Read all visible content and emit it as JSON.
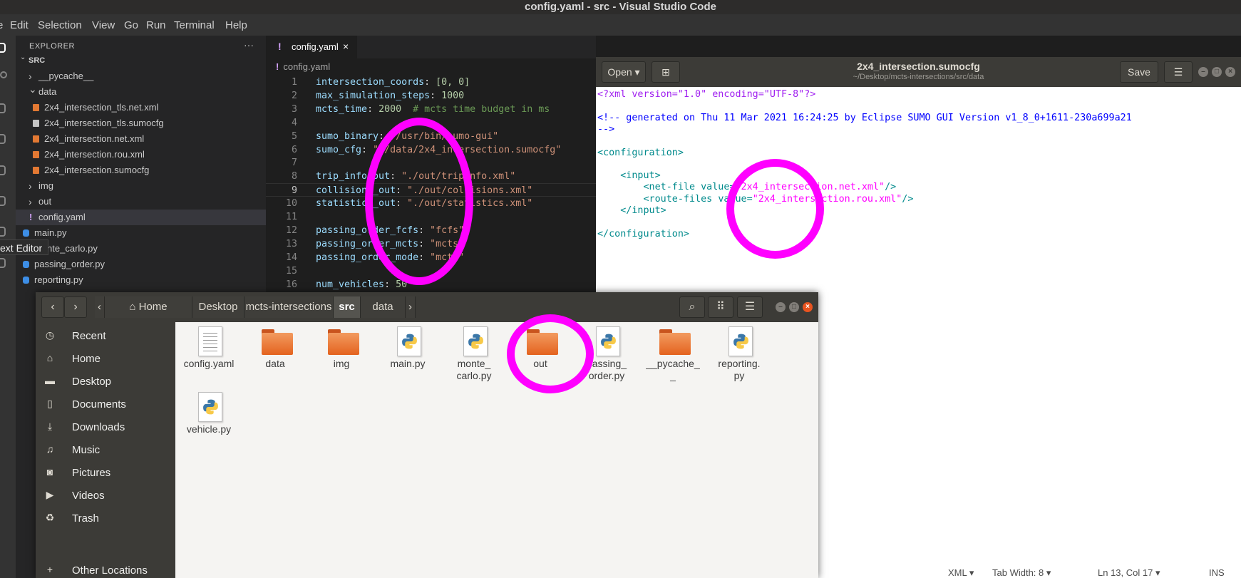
{
  "vscode": {
    "title": "config.yaml - src - Visual Studio Code",
    "menu": [
      "e",
      "Edit",
      "Selection",
      "View",
      "Go",
      "Run",
      "Terminal",
      "Help"
    ],
    "explorer_header": "EXPLORER",
    "more_icon": "···",
    "tooltip": "ext Editor",
    "tree": [
      {
        "label": "SRC",
        "kind": "root"
      },
      {
        "label": "__pycache__",
        "kind": "folder",
        "open": false
      },
      {
        "label": "data",
        "kind": "folder",
        "open": true
      },
      {
        "label": "2x4_intersection_tls.net.xml",
        "kind": "xml"
      },
      {
        "label": "2x4_intersection_tls.sumocfg",
        "kind": "cfg"
      },
      {
        "label": "2x4_intersection.net.xml",
        "kind": "xml"
      },
      {
        "label": "2x4_intersection.rou.xml",
        "kind": "xml"
      },
      {
        "label": "2x4_intersection.sumocfg",
        "kind": "xml"
      },
      {
        "label": "img",
        "kind": "folder",
        "open": false
      },
      {
        "label": "out",
        "kind": "folder",
        "open": false
      },
      {
        "label": "config.yaml",
        "kind": "yaml",
        "selected": true
      },
      {
        "label": "main.py",
        "kind": "py"
      },
      {
        "label": "monte_carlo.py",
        "kind": "py"
      },
      {
        "label": "passing_order.py",
        "kind": "py"
      },
      {
        "label": "reporting.py",
        "kind": "py"
      }
    ],
    "tab": {
      "label": "config.yaml",
      "bang": "!",
      "close": "×"
    },
    "breadcrumb": "config.yaml",
    "code": [
      {
        "n": "1",
        "k": "intersection_coords",
        "v": "[0, 0]",
        "vt": "n"
      },
      {
        "n": "2",
        "k": "max_simulation_steps",
        "v": "1000",
        "vt": "n"
      },
      {
        "n": "3",
        "k": "mcts_time",
        "v": "2000",
        "vt": "n",
        "c": "# mcts time budget in ms"
      },
      {
        "n": "4",
        "k": "",
        "v": ""
      },
      {
        "n": "5",
        "k": "sumo_binary",
        "v": "\"/usr/bin/sumo-gui\"",
        "vt": "s"
      },
      {
        "n": "6",
        "k": "sumo_cfg",
        "v": "\"./data/2x4_intersection.sumocfg\"",
        "vt": "s"
      },
      {
        "n": "7",
        "k": "",
        "v": ""
      },
      {
        "n": "8",
        "k": "trip_info_out",
        "v": "\"./out/tripinfo.xml\"",
        "vt": "s"
      },
      {
        "n": "9",
        "k": "collisions_out",
        "v": "\"./out/collisions.xml\"",
        "vt": "s",
        "cur": true
      },
      {
        "n": "10",
        "k": "statistics_out",
        "v": "\"./out/statistics.xml\"",
        "vt": "s"
      },
      {
        "n": "11",
        "k": "",
        "v": ""
      },
      {
        "n": "12",
        "k": "passing_order_fcfs",
        "v": "\"fcfs\"",
        "vt": "s"
      },
      {
        "n": "13",
        "k": "passing_order_mcts",
        "v": "\"mcts\"",
        "vt": "s"
      },
      {
        "n": "14",
        "k": "passing_order_mode",
        "v": "\"mcts\"",
        "vt": "s"
      },
      {
        "n": "15",
        "k": "",
        "v": ""
      },
      {
        "n": "16",
        "k": "num_vehicles",
        "v": "50",
        "vt": "n"
      }
    ]
  },
  "gedit": {
    "open_label": "Open",
    "save_label": "Save",
    "title": "2x4_intersection.sumocfg",
    "subtitle": "~/Desktop/mcts-intersections/src/data",
    "lines": [
      {
        "parts": [
          [
            "xd",
            "<?xml version=\"1.0\" encoding=\"UTF-8\"?>"
          ]
        ]
      },
      {
        "parts": []
      },
      {
        "parts": [
          [
            "xc",
            "<!-- generated on Thu 11 Mar 2021 16:24:25 by Eclipse SUMO GUI Version v1_8_0+1611-230a699a21"
          ]
        ]
      },
      {
        "parts": [
          [
            "xc",
            "-->"
          ]
        ]
      },
      {
        "parts": []
      },
      {
        "parts": [
          [
            "xt",
            "<configuration>"
          ]
        ]
      },
      {
        "parts": []
      },
      {
        "parts": [
          [
            "xt",
            "    <input>"
          ]
        ]
      },
      {
        "parts": [
          [
            "xt",
            "        <net-file "
          ],
          [
            "xa",
            "value="
          ],
          [
            "xv",
            "\"2x4_intersection.net.xml\""
          ],
          [
            "xt",
            "/>"
          ]
        ]
      },
      {
        "parts": [
          [
            "xt",
            "        <route-files "
          ],
          [
            "xa",
            "value="
          ],
          [
            "xv",
            "\"2x4_intersection.rou.xml\""
          ],
          [
            "xt",
            "/>"
          ]
        ]
      },
      {
        "parts": [
          [
            "xt",
            "    </input>"
          ]
        ]
      },
      {
        "parts": []
      },
      {
        "parts": [
          [
            "xt",
            "</configuration>"
          ]
        ]
      }
    ],
    "status": {
      "lang": "XML",
      "tab_width": "Tab Width: 8",
      "position": "Ln 13, Col 17",
      "mode": "INS"
    }
  },
  "files": {
    "path": [
      "Home",
      "Desktop",
      "mcts-intersections",
      "src",
      "data"
    ],
    "places": [
      {
        "icon": "clock-icon",
        "label": "Recent"
      },
      {
        "icon": "home-icon",
        "label": "Home"
      },
      {
        "icon": "folder-icon",
        "label": "Desktop"
      },
      {
        "icon": "document-icon",
        "label": "Documents"
      },
      {
        "icon": "download-icon",
        "label": "Downloads"
      },
      {
        "icon": "music-icon",
        "label": "Music"
      },
      {
        "icon": "camera-icon",
        "label": "Pictures"
      },
      {
        "icon": "video-icon",
        "label": "Videos"
      },
      {
        "icon": "trash-icon",
        "label": "Trash"
      },
      {
        "icon": "plus-icon",
        "label": "Other Locations"
      }
    ],
    "items": [
      {
        "label": "config.yaml",
        "type": "text"
      },
      {
        "label": "data",
        "type": "folder"
      },
      {
        "label": "img",
        "type": "folder"
      },
      {
        "label": "main.py",
        "type": "python"
      },
      {
        "label": "monte_\ncarlo.py",
        "type": "python"
      },
      {
        "label": "out",
        "type": "folder"
      },
      {
        "label": "passing_\norder.py",
        "type": "python"
      },
      {
        "label": "__pycache_\n_",
        "type": "folder"
      },
      {
        "label": "reporting.\npy",
        "type": "python"
      },
      {
        "label": "vehicle.py",
        "type": "python"
      }
    ]
  },
  "colors": {
    "annotation": "#ff00ff",
    "folder": "#e4631f",
    "yaml_key": "#9cdcfe",
    "yaml_string": "#ce9178"
  }
}
